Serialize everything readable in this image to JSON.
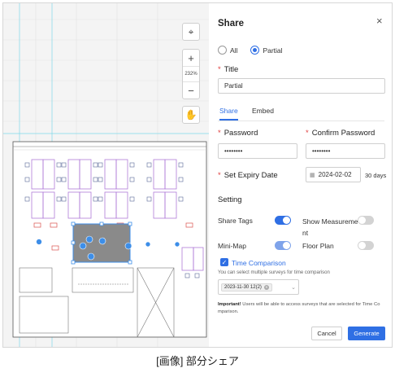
{
  "map_tools": {
    "recenter_icon": "crosshair-icon",
    "zoom_in_label": "+",
    "zoom_level": "232%",
    "zoom_out_label": "−",
    "pan_icon": "hand-icon"
  },
  "panel": {
    "title": "Share",
    "close_label": "×",
    "scope": {
      "all_label": "All",
      "partial_label": "Partial",
      "selected": "Partial"
    },
    "title_field": {
      "label": "Title",
      "value": "Partial"
    },
    "tabs": [
      {
        "label": "Share",
        "active": true
      },
      {
        "label": "Embed",
        "active": false
      }
    ],
    "password": {
      "label": "Password",
      "value": "••••••••"
    },
    "confirm_password": {
      "label": "Confirm Password",
      "value": "••••••••"
    },
    "expiry": {
      "label": "Set Expiry Date",
      "date": "2024-02-02",
      "days": "30 days"
    },
    "setting_heading": "Setting",
    "toggles": {
      "share_tags": {
        "label": "Share Tags",
        "on": true
      },
      "show_measurement": {
        "label_line1": "Show Measureme",
        "label_line2": "nt",
        "on": false
      },
      "mini_map": {
        "label": "Mini-Map",
        "on": true
      },
      "floor_plan": {
        "label": "Floor Plan",
        "on": false
      }
    },
    "time_comparison": {
      "label": "Time Comparison",
      "checked": true,
      "hint": "You can select multiple surveys for time comparison",
      "selected_chip": "2023-11-30 12(2)"
    },
    "important_prefix": "Important!",
    "important_text": " Users will be able to access surveys that are selected for Time Co mparison.",
    "cancel_label": "Cancel",
    "generate_label": "Generate"
  },
  "caption": "[画像] 部分シェア",
  "colors": {
    "accent": "#2f6fe4",
    "required": "#e04040",
    "selection_marker": "#3d8ee8",
    "plan_line": "#b07ad8"
  }
}
